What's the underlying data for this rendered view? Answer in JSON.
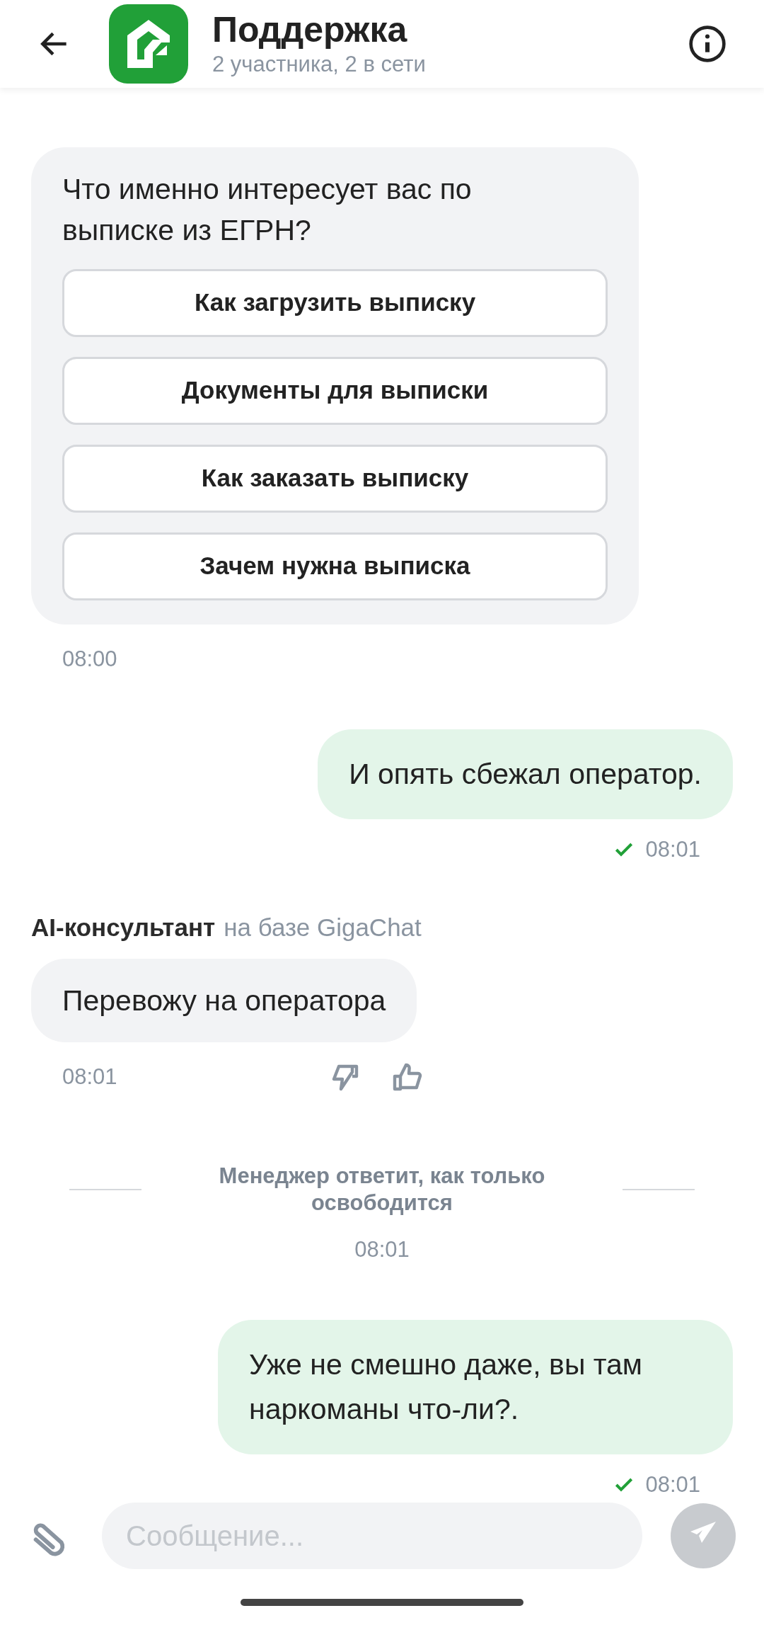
{
  "header": {
    "title": "Поддержка",
    "subtitle": "2 участника, 2 в сети"
  },
  "messages": [
    {
      "kind": "incoming",
      "text": "Что именно интересует вас по выписке из ЕГРН?",
      "options": [
        "Как загрузить выписку",
        "Документы для выписки",
        "Как заказать выписку",
        "Зачем нужна выписка"
      ],
      "time": "08:00",
      "feedback": false
    },
    {
      "kind": "outgoing",
      "text": "И опять сбежал оператор.",
      "time": "08:01",
      "delivered": true
    },
    {
      "kind": "incoming",
      "sender": {
        "name": "AI-консультант",
        "note": "на базе GigaChat"
      },
      "text": "Перевожу на оператора",
      "time": "08:01",
      "feedback": true
    },
    {
      "kind": "system",
      "text": "Менеджер ответит, как только освободится",
      "time": "08:01"
    },
    {
      "kind": "outgoing",
      "text": "Уже не смешно даже, вы там наркоманы что-ли?.",
      "time": "08:01",
      "delivered": true
    }
  ],
  "composer": {
    "placeholder": "Сообщение..."
  }
}
